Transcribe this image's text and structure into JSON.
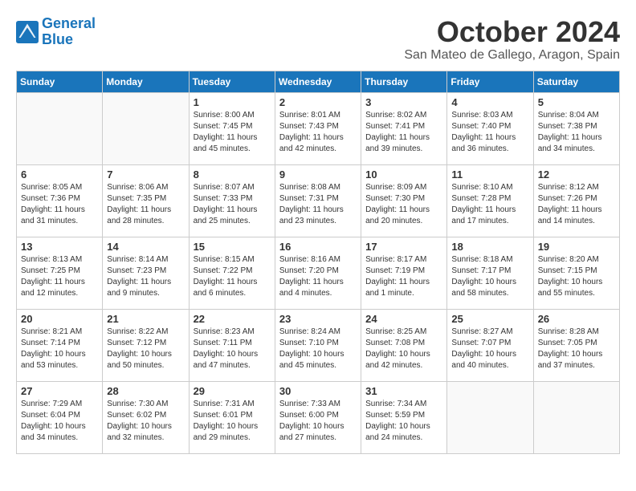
{
  "header": {
    "logo_line1": "General",
    "logo_line2": "Blue",
    "month": "October 2024",
    "location": "San Mateo de Gallego, Aragon, Spain"
  },
  "weekdays": [
    "Sunday",
    "Monday",
    "Tuesday",
    "Wednesday",
    "Thursday",
    "Friday",
    "Saturday"
  ],
  "weeks": [
    [
      {
        "day": "",
        "content": ""
      },
      {
        "day": "",
        "content": ""
      },
      {
        "day": "1",
        "content": "Sunrise: 8:00 AM\nSunset: 7:45 PM\nDaylight: 11 hours\nand 45 minutes."
      },
      {
        "day": "2",
        "content": "Sunrise: 8:01 AM\nSunset: 7:43 PM\nDaylight: 11 hours\nand 42 minutes."
      },
      {
        "day": "3",
        "content": "Sunrise: 8:02 AM\nSunset: 7:41 PM\nDaylight: 11 hours\nand 39 minutes."
      },
      {
        "day": "4",
        "content": "Sunrise: 8:03 AM\nSunset: 7:40 PM\nDaylight: 11 hours\nand 36 minutes."
      },
      {
        "day": "5",
        "content": "Sunrise: 8:04 AM\nSunset: 7:38 PM\nDaylight: 11 hours\nand 34 minutes."
      }
    ],
    [
      {
        "day": "6",
        "content": "Sunrise: 8:05 AM\nSunset: 7:36 PM\nDaylight: 11 hours\nand 31 minutes."
      },
      {
        "day": "7",
        "content": "Sunrise: 8:06 AM\nSunset: 7:35 PM\nDaylight: 11 hours\nand 28 minutes."
      },
      {
        "day": "8",
        "content": "Sunrise: 8:07 AM\nSunset: 7:33 PM\nDaylight: 11 hours\nand 25 minutes."
      },
      {
        "day": "9",
        "content": "Sunrise: 8:08 AM\nSunset: 7:31 PM\nDaylight: 11 hours\nand 23 minutes."
      },
      {
        "day": "10",
        "content": "Sunrise: 8:09 AM\nSunset: 7:30 PM\nDaylight: 11 hours\nand 20 minutes."
      },
      {
        "day": "11",
        "content": "Sunrise: 8:10 AM\nSunset: 7:28 PM\nDaylight: 11 hours\nand 17 minutes."
      },
      {
        "day": "12",
        "content": "Sunrise: 8:12 AM\nSunset: 7:26 PM\nDaylight: 11 hours\nand 14 minutes."
      }
    ],
    [
      {
        "day": "13",
        "content": "Sunrise: 8:13 AM\nSunset: 7:25 PM\nDaylight: 11 hours\nand 12 minutes."
      },
      {
        "day": "14",
        "content": "Sunrise: 8:14 AM\nSunset: 7:23 PM\nDaylight: 11 hours\nand 9 minutes."
      },
      {
        "day": "15",
        "content": "Sunrise: 8:15 AM\nSunset: 7:22 PM\nDaylight: 11 hours\nand 6 minutes."
      },
      {
        "day": "16",
        "content": "Sunrise: 8:16 AM\nSunset: 7:20 PM\nDaylight: 11 hours\nand 4 minutes."
      },
      {
        "day": "17",
        "content": "Sunrise: 8:17 AM\nSunset: 7:19 PM\nDaylight: 11 hours\nand 1 minute."
      },
      {
        "day": "18",
        "content": "Sunrise: 8:18 AM\nSunset: 7:17 PM\nDaylight: 10 hours\nand 58 minutes."
      },
      {
        "day": "19",
        "content": "Sunrise: 8:20 AM\nSunset: 7:15 PM\nDaylight: 10 hours\nand 55 minutes."
      }
    ],
    [
      {
        "day": "20",
        "content": "Sunrise: 8:21 AM\nSunset: 7:14 PM\nDaylight: 10 hours\nand 53 minutes."
      },
      {
        "day": "21",
        "content": "Sunrise: 8:22 AM\nSunset: 7:12 PM\nDaylight: 10 hours\nand 50 minutes."
      },
      {
        "day": "22",
        "content": "Sunrise: 8:23 AM\nSunset: 7:11 PM\nDaylight: 10 hours\nand 47 minutes."
      },
      {
        "day": "23",
        "content": "Sunrise: 8:24 AM\nSunset: 7:10 PM\nDaylight: 10 hours\nand 45 minutes."
      },
      {
        "day": "24",
        "content": "Sunrise: 8:25 AM\nSunset: 7:08 PM\nDaylight: 10 hours\nand 42 minutes."
      },
      {
        "day": "25",
        "content": "Sunrise: 8:27 AM\nSunset: 7:07 PM\nDaylight: 10 hours\nand 40 minutes."
      },
      {
        "day": "26",
        "content": "Sunrise: 8:28 AM\nSunset: 7:05 PM\nDaylight: 10 hours\nand 37 minutes."
      }
    ],
    [
      {
        "day": "27",
        "content": "Sunrise: 7:29 AM\nSunset: 6:04 PM\nDaylight: 10 hours\nand 34 minutes."
      },
      {
        "day": "28",
        "content": "Sunrise: 7:30 AM\nSunset: 6:02 PM\nDaylight: 10 hours\nand 32 minutes."
      },
      {
        "day": "29",
        "content": "Sunrise: 7:31 AM\nSunset: 6:01 PM\nDaylight: 10 hours\nand 29 minutes."
      },
      {
        "day": "30",
        "content": "Sunrise: 7:33 AM\nSunset: 6:00 PM\nDaylight: 10 hours\nand 27 minutes."
      },
      {
        "day": "31",
        "content": "Sunrise: 7:34 AM\nSunset: 5:59 PM\nDaylight: 10 hours\nand 24 minutes."
      },
      {
        "day": "",
        "content": ""
      },
      {
        "day": "",
        "content": ""
      }
    ]
  ]
}
